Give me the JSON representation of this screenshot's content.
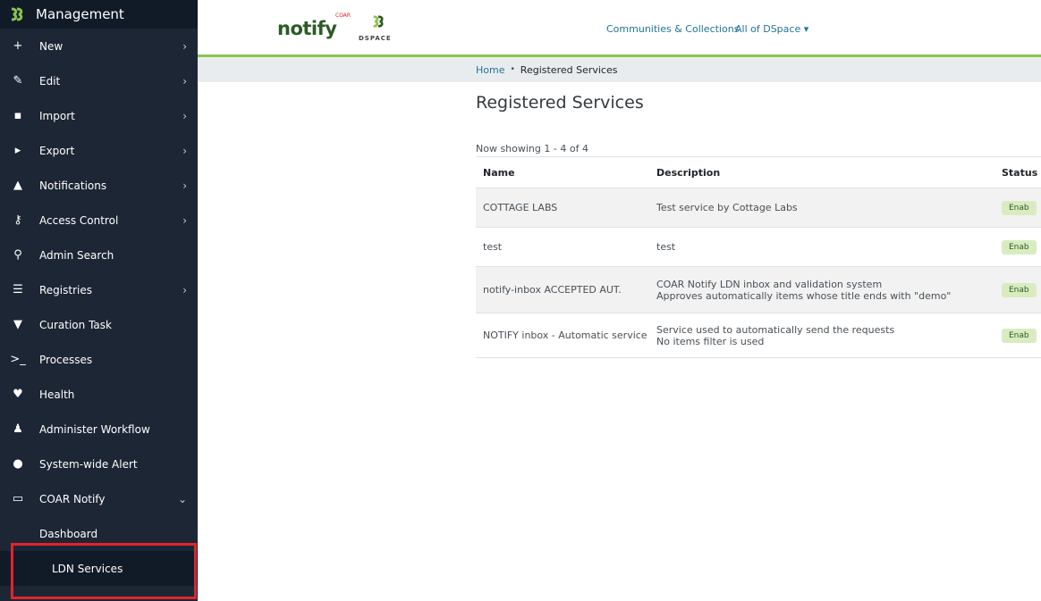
{
  "sidebar": {
    "title": "Management",
    "items": [
      {
        "label": "New",
        "icon": "plus-icon",
        "glyph": "+",
        "chevron": "›"
      },
      {
        "label": "Edit",
        "icon": "pencil-icon",
        "glyph": "✎",
        "chevron": "›"
      },
      {
        "label": "Import",
        "icon": "file-import-icon",
        "glyph": "▪",
        "chevron": "›"
      },
      {
        "label": "Export",
        "icon": "file-export-icon",
        "glyph": "▸",
        "chevron": "›"
      },
      {
        "label": "Notifications",
        "icon": "bell-icon",
        "glyph": "▲",
        "chevron": "›"
      },
      {
        "label": "Access Control",
        "icon": "key-icon",
        "glyph": "⚷",
        "chevron": "›"
      },
      {
        "label": "Admin Search",
        "icon": "search-icon",
        "glyph": "⚲",
        "chevron": ""
      },
      {
        "label": "Registries",
        "icon": "list-icon",
        "glyph": "☰",
        "chevron": "›"
      },
      {
        "label": "Curation Task",
        "icon": "filter-icon",
        "glyph": "▼",
        "chevron": ""
      },
      {
        "label": "Processes",
        "icon": "terminal-icon",
        "glyph": ">_",
        "chevron": ""
      },
      {
        "label": "Health",
        "icon": "heartbeat-icon",
        "glyph": "♥",
        "chevron": ""
      },
      {
        "label": "Administer Workflow",
        "icon": "user-check-icon",
        "glyph": "♟",
        "chevron": ""
      },
      {
        "label": "System-wide Alert",
        "icon": "exclamation-circle-icon",
        "glyph": "●",
        "chevron": ""
      },
      {
        "label": "COAR Notify",
        "icon": "inbox-icon",
        "glyph": "▭",
        "chevron": "⌄"
      }
    ],
    "subitems": [
      {
        "label": "Dashboard"
      },
      {
        "label": "LDN Services"
      }
    ]
  },
  "header": {
    "brand_notify": "notify",
    "brand_coar": "COAR",
    "brand_dspace": "DSPACE",
    "nav": {
      "communities": "Communities & Collections",
      "all_dspace": "All of DSpace ▾"
    }
  },
  "breadcrumb": {
    "home": "Home",
    "separator": "•",
    "current": "Registered Services"
  },
  "main": {
    "title": "Registered Services",
    "showing": "Now showing 1 - 4 of 4",
    "columns": [
      "Name",
      "Description",
      "Status"
    ],
    "rows": [
      {
        "name": "COTTAGE LABS",
        "desc1": "Test service by Cottage Labs",
        "desc2": "",
        "status": "Enab"
      },
      {
        "name": "test",
        "desc1": "test",
        "desc2": "",
        "status": "Enab"
      },
      {
        "name": "notify-inbox ACCEPTED AUT.",
        "desc1": "COAR Notify LDN inbox and validation system",
        "desc2": "Approves automatically items whose title ends with \"demo\"",
        "status": "Enab"
      },
      {
        "name": "NOTIFY inbox - Automatic service",
        "desc1": "Service used to automatically send the requests",
        "desc2": "No items filter is used",
        "status": "Enab"
      }
    ]
  },
  "colors": {
    "sidebar_bg": "#1d2634",
    "accent_green": "#8bc34a",
    "link_blue": "#207698",
    "highlight_red": "#e2242c"
  }
}
